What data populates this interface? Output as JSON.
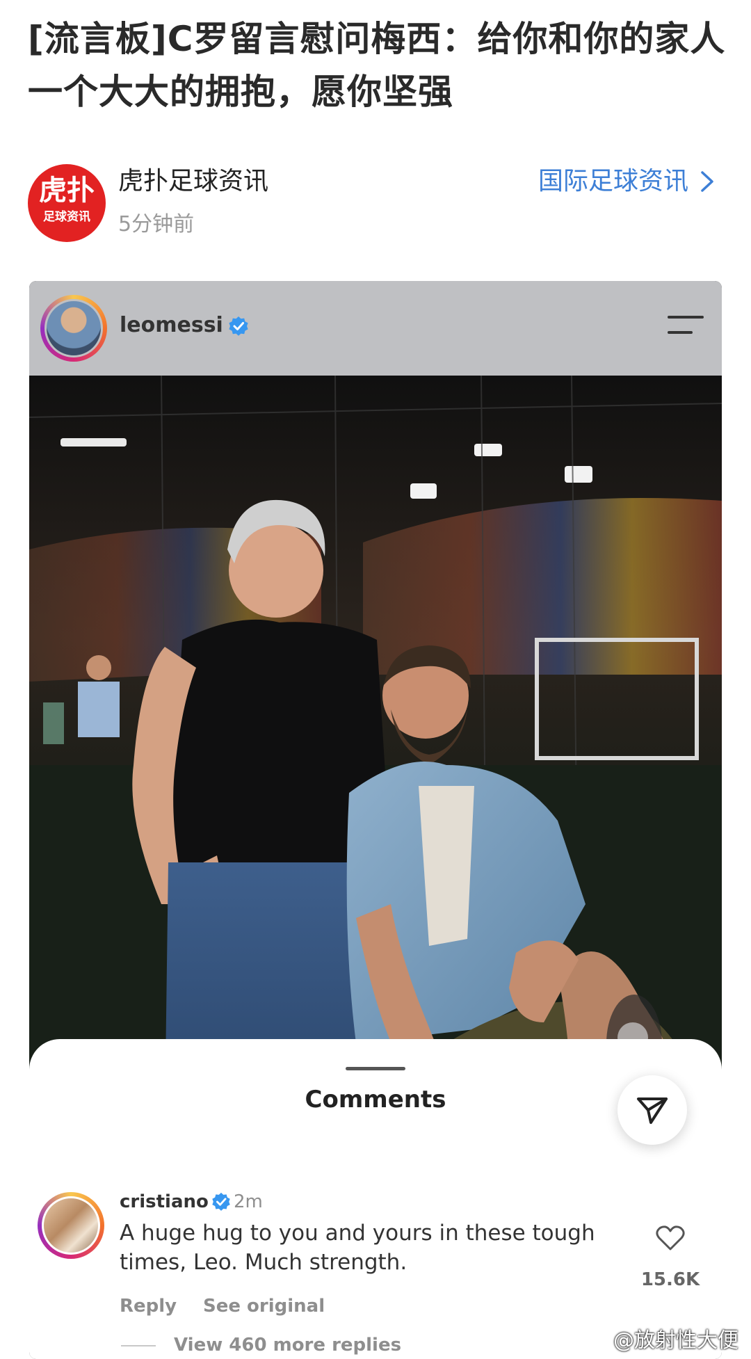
{
  "article": {
    "headline": "[流言板]C罗留言慰问梅西：给你和你的家人一个大大的拥抱，愿你坚强"
  },
  "author": {
    "logo_text": "虎扑",
    "logo_subtext": "足球资讯",
    "name": "虎扑足球资讯",
    "time": "5分钟前",
    "channel_link": "国际足球资讯"
  },
  "instagram_post": {
    "username": "leomessi",
    "verified": true
  },
  "comments_sheet": {
    "title": "Comments",
    "comment": {
      "username": "cristiano",
      "verified": true,
      "time": "2m",
      "text": "A huge hug to you and yours in these tough times, Leo. Much strength.",
      "likes": "15.6K",
      "reply_label": "Reply",
      "see_original_label": "See original",
      "view_more_replies": "View 460 more replies"
    }
  },
  "watermark": "@放射性大便",
  "colors": {
    "link_blue": "#3d7fd6",
    "logo_red": "#e22222",
    "verified_blue": "#3797f0"
  }
}
